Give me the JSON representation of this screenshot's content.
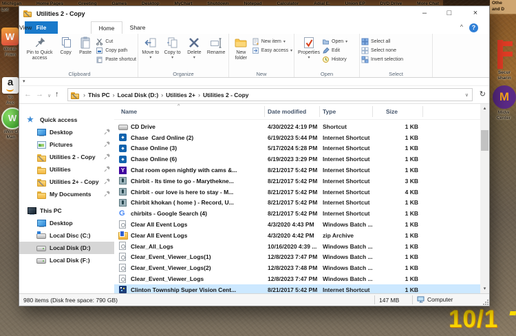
{
  "glyphs": {
    "min": "–",
    "max": "□",
    "close": "×",
    "collapse": "^",
    "help": "?",
    "back": "←",
    "forward": "→",
    "drop": "∨",
    "up": "↑",
    "refresh": "↻",
    "caret": "▾",
    "crumb_sep": "›",
    "sort": "^",
    "scroll_up": "▴",
    "scroll_down": "▾",
    "qat": "▾"
  },
  "desktop": {
    "top_labels": [
      "Michigan",
      "Home Pages",
      "Greeting",
      "Games",
      "Desktop",
      "MyChart",
      "Shutdown",
      "Notepad",
      "Calculator",
      "Adial E.",
      "Union EP",
      "DVD Drive",
      "More Chat"
    ],
    "corner_lines": "Othe\nand D",
    "left_partial_label": "Lot",
    "left_icons": [
      {
        "icon": "words-with-friends",
        "lines": "Word-\nFrien"
      },
      {
        "icon": "amazon",
        "lines": "Yo\nAcc"
      },
      {
        "icon": "iwin",
        "lines": "iWin G\nMan"
      }
    ],
    "right_icons": [
      {
        "icon": "secure",
        "lines": "Secur\nsharin"
      },
      {
        "icon": "midway",
        "lines": "Midw\nCenter"
      }
    ],
    "date_overlay": "10/1"
  },
  "titlebar": {
    "title": "Utilities 2 - Copy"
  },
  "tabs": [
    {
      "label": "File",
      "kind": "file"
    },
    {
      "label": "Home",
      "kind": "selected"
    },
    {
      "label": "Share",
      "kind": "normal"
    },
    {
      "label": "View",
      "kind": "normal"
    }
  ],
  "ribbon": {
    "clipboard": {
      "pin": "Pin to Quick access",
      "copy": "Copy",
      "paste": "Paste",
      "cut": "Cut",
      "copy_path": "Copy path",
      "paste_shortcut": "Paste shortcut",
      "label": "Clipboard"
    },
    "organize": {
      "move": "Move to",
      "copy": "Copy to",
      "delete": "Delete",
      "rename": "Rename",
      "label": "Organize"
    },
    "new_group": {
      "folder": "New folder",
      "item": "New item",
      "easy": "Easy access",
      "label": "New"
    },
    "open_group": {
      "properties": "Properties",
      "open": "Open",
      "edit": "Edit",
      "history": "History",
      "label": "Open"
    },
    "select_group": {
      "all": "Select all",
      "none": "Select none",
      "invert": "Invert selection",
      "label": "Select"
    }
  },
  "address": {
    "crumbs": [
      "This PC",
      "Local Disk (D:)",
      "Utilities 2+",
      "Utilities 2 - Copy"
    ]
  },
  "sidebar": {
    "items": [
      {
        "label": "Quick access",
        "icon": "star",
        "level": 0
      },
      {
        "label": "Desktop",
        "icon": "monitor",
        "level": 1,
        "pin": true
      },
      {
        "label": "Pictures",
        "icon": "pictures",
        "level": 1,
        "pin": true
      },
      {
        "label": "Utilities 2 - Copy",
        "icon": "folderkey",
        "level": 1,
        "pin": true
      },
      {
        "label": "Utilities",
        "icon": "folder",
        "level": 1,
        "pin": true
      },
      {
        "label": "Utilities 2+ - Copy",
        "icon": "folderkey",
        "level": 1,
        "pin": true
      },
      {
        "label": "My Documents",
        "icon": "folder",
        "level": 1,
        "pin": true
      },
      {
        "label": "This PC",
        "icon": "pc",
        "level": 0,
        "gap": true
      },
      {
        "label": "Desktop",
        "icon": "monitor",
        "level": 1
      },
      {
        "label": "Local Disc (C:)",
        "icon": "drivec",
        "level": 1
      },
      {
        "label": "Local Disk (D:)",
        "icon": "drive",
        "level": 1,
        "selected": true
      },
      {
        "label": "Local Disk (F:)",
        "icon": "drive",
        "level": 1
      }
    ]
  },
  "files": {
    "columns": {
      "name": "Name",
      "date": "Date modified",
      "type": "Type",
      "size": "Size"
    },
    "rows": [
      {
        "icon": "drive",
        "name": "CD Drive",
        "date": "4/30/2022 4:19 PM",
        "type": "Shortcut",
        "size": "1 KB"
      },
      {
        "icon": "chase",
        "name": "Chase  Card Online (2)",
        "date": "6/19/2023 5:44 PM",
        "type": "Internet Shortcut",
        "size": "1 KB"
      },
      {
        "icon": "chase",
        "name": "Chase Online (3)",
        "date": "5/17/2024 5:28 PM",
        "type": "Internet Shortcut",
        "size": "1 KB"
      },
      {
        "icon": "chase",
        "name": "Chase Online (6)",
        "date": "6/19/2023 3:29 PM",
        "type": "Internet Shortcut",
        "size": "1 KB"
      },
      {
        "icon": "yahoo",
        "name": "Chat room open nightly with cams &...",
        "date": "8/21/2017 5:42 PM",
        "type": "Internet Shortcut",
        "size": "1 KB"
      },
      {
        "icon": "chirbit",
        "name": "Chirbit - Its time to go - Marythekne...",
        "date": "8/21/2017 5:42 PM",
        "type": "Internet Shortcut",
        "size": "3 KB"
      },
      {
        "icon": "chirbit",
        "name": "Chirbit - our love is here to stay - M...",
        "date": "8/21/2017 5:42 PM",
        "type": "Internet Shortcut",
        "size": "4 KB"
      },
      {
        "icon": "chirbit",
        "name": "Chirbit khokan ( home ) - Record, U...",
        "date": "8/21/2017 5:42 PM",
        "type": "Internet Shortcut",
        "size": "1 KB"
      },
      {
        "icon": "google",
        "name": "chirbits - Google Search (4)",
        "date": "8/21/2017 5:42 PM",
        "type": "Internet Shortcut",
        "size": "1 KB"
      },
      {
        "icon": "batch",
        "name": "Clear All Event Logs",
        "date": "4/3/2020 4:43 PM",
        "type": "Windows Batch ...",
        "size": "1 KB"
      },
      {
        "icon": "zip",
        "name": "Clear All Event Logs",
        "date": "4/3/2020 4:42 PM",
        "type": "zip Archive",
        "size": "1 KB"
      },
      {
        "icon": "batch",
        "name": "Clear_All_Logs",
        "date": "10/16/2020 4:39 ...",
        "type": "Windows Batch ...",
        "size": "1 KB"
      },
      {
        "icon": "batch",
        "name": "Clear_Event_Viewer_Logs(1)",
        "date": "12/8/2023 7:47 PM",
        "type": "Windows Batch ...",
        "size": "1 KB"
      },
      {
        "icon": "batch",
        "name": "Clear_Event_Viewer_Logs(2)",
        "date": "12/8/2023 7:48 PM",
        "type": "Windows Batch ...",
        "size": "1 KB"
      },
      {
        "icon": "batch",
        "name": "Clear_Event_Viewer_Logs",
        "date": "12/8/2023 7:47 PM",
        "type": "Windows Batch ...",
        "size": "1 KB"
      },
      {
        "icon": "clinton",
        "name": "Clinton Township Super Vision Cent...",
        "date": "8/21/2017 5:42 PM",
        "type": "Internet Shortcut",
        "size": "1 KB",
        "selected": true
      }
    ]
  },
  "statusbar": {
    "items": "980 items (Disk free space: 790 GB)",
    "selected_size": "147 MB",
    "view": "Computer"
  }
}
